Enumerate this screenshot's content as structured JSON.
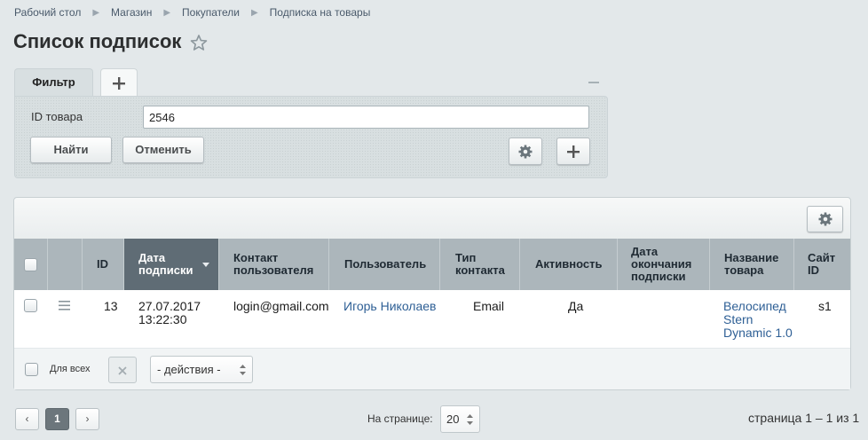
{
  "breadcrumb": [
    "Рабочий стол",
    "Магазин",
    "Покупатели",
    "Подписка на товары"
  ],
  "page_title": "Список подписок",
  "filter": {
    "tab_label": "Фильтр",
    "field_label": "ID товара",
    "field_value": "2546",
    "find_label": "Найти",
    "cancel_label": "Отменить"
  },
  "table": {
    "headers": {
      "id": "ID",
      "date_sub": "Дата подписки",
      "contact": "Контакт пользователя",
      "user": "Пользователь",
      "contact_type": "Тип контакта",
      "active": "Активность",
      "date_end": "Дата окончания подписки",
      "product": "Название товара",
      "site": "Сайт ID"
    },
    "row": {
      "id": "13",
      "date": "27.07.2017",
      "time": "13:22:30",
      "contact": "login@gmail.com",
      "user": "Игорь Николаев",
      "contact_type": "Email",
      "active": "Да",
      "date_end": "",
      "product": "Велосипед Stern Dynamic 1.0",
      "site": "s1"
    }
  },
  "footer": {
    "for_all": "Для всех",
    "actions_placeholder": "- действия -"
  },
  "pagination": {
    "prev": "‹",
    "current": "1",
    "next": "›",
    "per_page_label": "На странице:",
    "per_page_value": "20",
    "page_info": "страница 1 – 1 из 1"
  },
  "colors": {
    "background": "#e3e8ea",
    "header": "#acb6bb",
    "sorted_header": "#5f6c75",
    "link": "#2e5f95"
  },
  "icons": [
    "star-icon",
    "plus-icon",
    "minus-icon",
    "gear-icon",
    "close-icon",
    "menu-icon",
    "sort-down-icon",
    "updown-icon"
  ]
}
